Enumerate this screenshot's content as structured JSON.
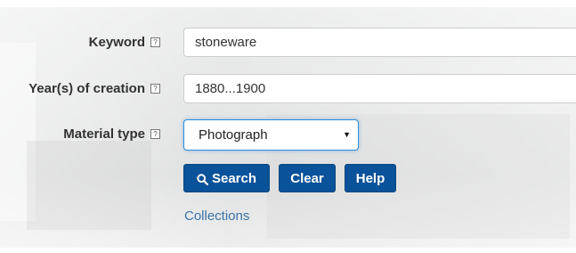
{
  "form": {
    "keyword": {
      "label": "Keyword",
      "help": "?",
      "value": "stoneware"
    },
    "years": {
      "label": "Year(s) of creation",
      "help": "?",
      "value": "1880...1900"
    },
    "material": {
      "label": "Material type",
      "help": "?",
      "selected": "Photograph"
    }
  },
  "buttons": {
    "search": "Search",
    "clear": "Clear",
    "help": "Help"
  },
  "links": {
    "collections": "Collections"
  },
  "colors": {
    "button_bg": "#0a5299",
    "link": "#3a73a8",
    "focus_border": "#2c8dd8"
  },
  "icons": {
    "search": "magnifier-icon",
    "select_arrow": "triangle-down-icon"
  }
}
